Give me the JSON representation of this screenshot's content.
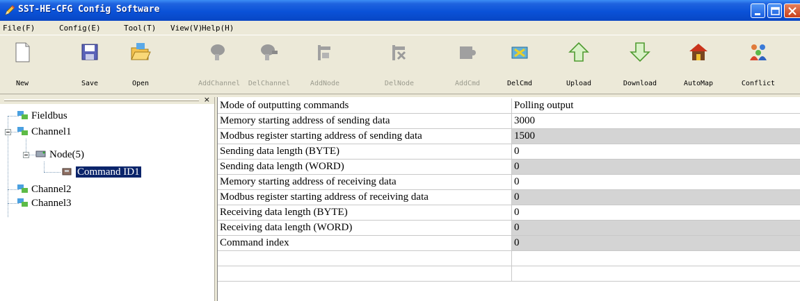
{
  "window": {
    "title": "SST-HE-CFG Config Software"
  },
  "menu": [
    "File(F)",
    "Config(E)",
    "Tool(T)",
    "View(V)",
    "Help(H)"
  ],
  "toolbar": [
    {
      "label": "New",
      "icon": "new-file-icon",
      "enabled": true
    },
    {
      "label": "Save",
      "icon": "save-icon",
      "enabled": true
    },
    {
      "label": "Open",
      "icon": "open-folder-icon",
      "enabled": true
    },
    {
      "label": "AddChannel",
      "icon": "add-channel-icon",
      "enabled": false
    },
    {
      "label": "DelChannel",
      "icon": "del-channel-icon",
      "enabled": false
    },
    {
      "label": "AddNode",
      "icon": "add-node-icon",
      "enabled": false
    },
    {
      "label": "DelNode",
      "icon": "del-node-icon",
      "enabled": false
    },
    {
      "label": "AddCmd",
      "icon": "add-cmd-icon",
      "enabled": false
    },
    {
      "label": "DelCmd",
      "icon": "del-cmd-icon",
      "enabled": true
    },
    {
      "label": "Upload",
      "icon": "upload-arrow-icon",
      "enabled": true
    },
    {
      "label": "Download",
      "icon": "download-arrow-icon",
      "enabled": true
    },
    {
      "label": "AutoMap",
      "icon": "automap-house-icon",
      "enabled": true
    },
    {
      "label": "Conflict",
      "icon": "conflict-people-icon",
      "enabled": true
    }
  ],
  "tree": {
    "root": "Fieldbus",
    "channel1": "Channel1",
    "node": "Node(5)",
    "command": "Command ID1",
    "channel2": "Channel2",
    "channel3": "Channel3"
  },
  "properties": [
    {
      "name": "Mode of outputting commands",
      "value": "Polling output",
      "shaded": false
    },
    {
      "name": "Memory starting address of sending data",
      "value": "3000",
      "shaded": false
    },
    {
      "name": "Modbus register starting address of sending data",
      "value": "1500",
      "shaded": true
    },
    {
      "name": "Sending data length (BYTE)",
      "value": "0",
      "shaded": false
    },
    {
      "name": "Sending data length (WORD)",
      "value": "0",
      "shaded": true
    },
    {
      "name": "Memory starting address of receiving data",
      "value": "0",
      "shaded": false
    },
    {
      "name": "Modbus register starting address of receiving data",
      "value": "0",
      "shaded": true
    },
    {
      "name": "Receiving data length (BYTE)",
      "value": "0",
      "shaded": false
    },
    {
      "name": "Receiving data length (WORD)",
      "value": "0",
      "shaded": true
    },
    {
      "name": "Command index",
      "value": "0",
      "shaded": true
    },
    {
      "name": "",
      "value": "",
      "shaded": false
    },
    {
      "name": "",
      "value": "",
      "shaded": false
    }
  ],
  "colors": {
    "titlebar": "#0a52d8",
    "selection": "#0a246a",
    "shaded_cell": "#d4d4d4",
    "chrome": "#ece9d8"
  }
}
